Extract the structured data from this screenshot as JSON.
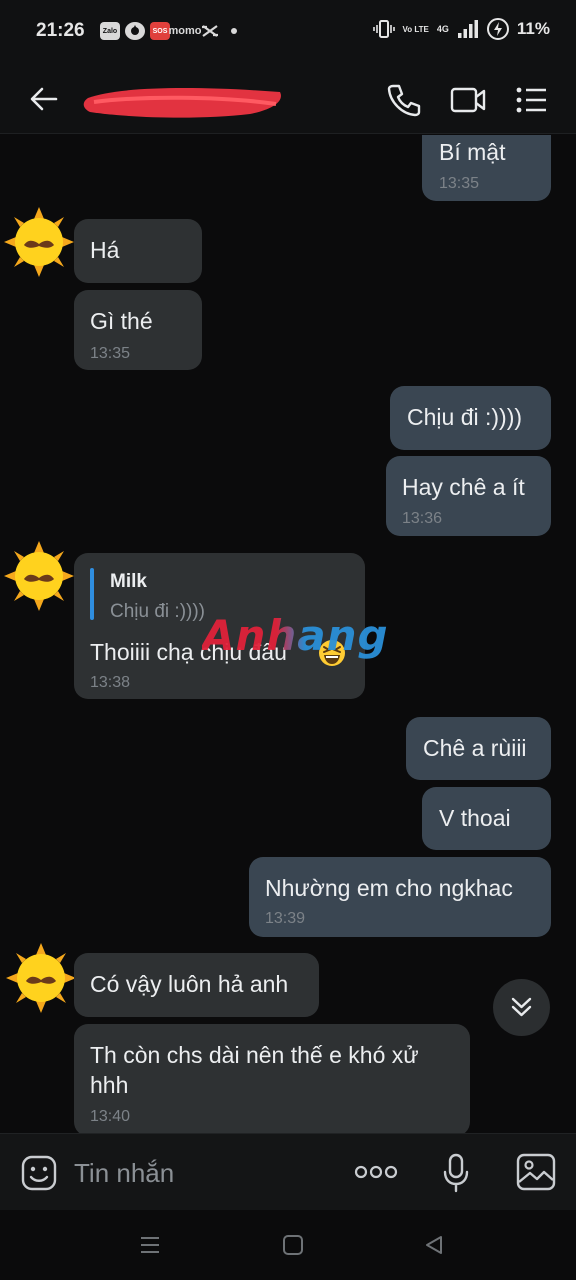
{
  "status_bar": {
    "time": "21:26",
    "app_icons": [
      "Zalo",
      "SOS",
      "momo"
    ],
    "volte": "Vo LTE",
    "network": "4G",
    "battery": "11%"
  },
  "header": {
    "contact_name": "",
    "icons": [
      "back-arrow-icon",
      "phone-icon",
      "video-call-icon",
      "menu-icon"
    ]
  },
  "messages": [
    {
      "direction": "out",
      "text": "Bí mật",
      "time": "13:35"
    },
    {
      "direction": "in",
      "text": "Há"
    },
    {
      "direction": "in",
      "text": "Gì thé",
      "time": "13:35"
    },
    {
      "direction": "out",
      "text": "Chịu đi :))))"
    },
    {
      "direction": "out",
      "text": "Hay chê a ít",
      "time": "13:36"
    },
    {
      "direction": "in",
      "reply_to": {
        "name": "Milk",
        "text": "Chịu đi :))))"
      },
      "text": "Thoiiii chạ chịu đâu",
      "emoji": "grinning-squinting-face",
      "time": "13:38"
    },
    {
      "direction": "out",
      "text": "Chê a rùiii"
    },
    {
      "direction": "out",
      "text": "V thoai"
    },
    {
      "direction": "out",
      "text": "Nhường em cho ngkhac",
      "time": "13:39"
    },
    {
      "direction": "in",
      "text": "Có vậy luôn hả anh"
    },
    {
      "direction": "in",
      "text_lines": [
        "Th còn chs dài nên thế e khó xử",
        "hhh"
      ],
      "time": "13:40"
    }
  ],
  "watermark": "Anhang",
  "input": {
    "placeholder": "Tin nhắn",
    "icons": [
      "sticker-icon",
      "more-icon",
      "microphone-icon",
      "image-icon"
    ]
  },
  "colors": {
    "background": "#0b0b0c",
    "incoming_bubble": "#2e3133",
    "outgoing_bubble": "#3a4652",
    "quote_bar": "#2f8ee0",
    "timestamp": "#7c8288"
  }
}
